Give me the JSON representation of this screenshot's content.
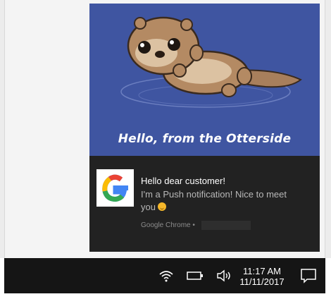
{
  "hero": {
    "caption": "Hello, from the Otterside"
  },
  "notification": {
    "title": "Hello dear customer!",
    "message_line1": "I'm a Push notification! Nice to meet",
    "message_line2": "you",
    "emoji": "smiling-face",
    "source": "Google Chrome •"
  },
  "taskbar": {
    "time": "11:17 AM",
    "date": "11/11/2017",
    "icons": [
      "wifi-icon",
      "battery-icon",
      "volume-icon",
      "action-center-icon"
    ]
  },
  "colors": {
    "hero_bg": "#3f55a1",
    "toast_bg": "#222222",
    "taskbar_bg": "#151515"
  }
}
